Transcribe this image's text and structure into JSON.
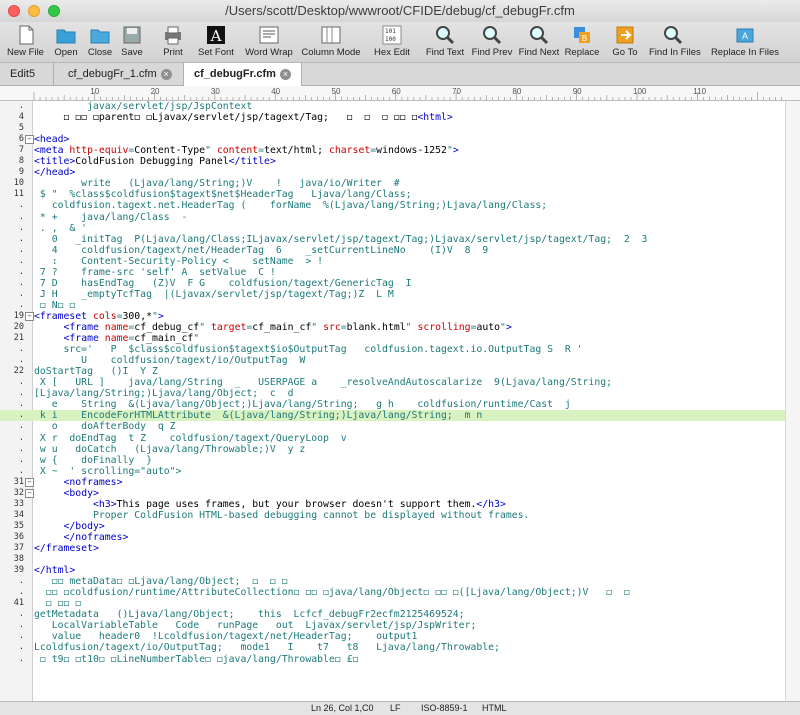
{
  "window": {
    "title": "/Users/scott/Desktop/wwwroot/CFIDE/debug/cf_debugFr.cfm"
  },
  "toolbar": [
    {
      "label": "New File",
      "icon": "new-file-icon"
    },
    {
      "label": "Open",
      "icon": "open-folder-icon"
    },
    {
      "label": "Close",
      "icon": "close-file-icon"
    },
    {
      "label": "Save",
      "icon": "save-icon"
    },
    {
      "label": "Print",
      "icon": "print-icon"
    },
    {
      "label": "Set Font",
      "icon": "font-icon"
    },
    {
      "label": "Word Wrap",
      "icon": "word-wrap-icon"
    },
    {
      "label": "Column Mode",
      "icon": "column-mode-icon"
    },
    {
      "label": "Hex Edit",
      "icon": "hex-edit-icon"
    },
    {
      "label": "Find Text",
      "icon": "find-text-icon"
    },
    {
      "label": "Find Prev",
      "icon": "find-prev-icon"
    },
    {
      "label": "Find Next",
      "icon": "find-next-icon"
    },
    {
      "label": "Replace",
      "icon": "replace-icon"
    },
    {
      "label": "Go To",
      "icon": "go-to-icon"
    },
    {
      "label": "Find In Files",
      "icon": "find-in-files-icon"
    },
    {
      "label": "Replace In Files",
      "icon": "replace-in-files-icon"
    }
  ],
  "tabs": [
    {
      "label": "Edit5",
      "active": false
    },
    {
      "label": "cf_debugFr_1.cfm",
      "active": false
    },
    {
      "label": "cf_debugFr.cfm",
      "active": true
    }
  ],
  "ruler": {
    "marks": [
      "10",
      "20",
      "30",
      "40",
      "50",
      "60",
      "70",
      "80",
      "90",
      "100",
      "110"
    ]
  },
  "lines": [
    {
      "n": ".",
      "fold": "",
      "text": "         javax/servlet/jsp/JspContext"
    },
    {
      "n": "4",
      "fold": "",
      "text": "     ◻ ◻◻ ◻parent◻ ◻Ljavax/servlet/jsp/tagext/Tag;   ◻  ◻  ◻ ◻◻ ◻<html>"
    },
    {
      "n": "5",
      "fold": "",
      "text": ""
    },
    {
      "n": "6",
      "fold": "−",
      "text": "<head>"
    },
    {
      "n": "7",
      "fold": "",
      "text": "<meta http-equiv=\"Content-Type\" content=\"text/html; charset=windows-1252\">"
    },
    {
      "n": "8",
      "fold": "",
      "text": "<title>ColdFusion Debugging Panel</title>"
    },
    {
      "n": "9",
      "fold": "",
      "text": "</head>"
    },
    {
      "n": "10",
      "fold": "",
      "text": "        write   (Ljava/lang/String;)V    !   java/io/Writer  #"
    },
    {
      "n": "11",
      "fold": "",
      "text": " $ \"  %class$coldfusion$tagext$net$HeaderTag   Ljava/lang/Class;"
    },
    {
      "n": ".",
      "fold": "",
      "text": "   coldfusion.tagext.net.HeaderTag (    forName  %(Ljava/lang/String;)Ljava/lang/Class;"
    },
    {
      "n": ".",
      "fold": "",
      "text": " * +    java/lang/Class  -"
    },
    {
      "n": ".",
      "fold": "",
      "text": " . ,  & '"
    },
    {
      "n": ".",
      "fold": "",
      "text": "   0   _initTag  P(Ljava/lang/Class;ILjavax/servlet/jsp/tagext/Tag;)Ljavax/servlet/jsp/tagext/Tag;  2  3"
    },
    {
      "n": ".",
      "fold": "",
      "text": "   4    coldfusion/tagext/net/HeaderTag  6    _setCurrentLineNo    (I)V  8  9"
    },
    {
      "n": ".",
      "fold": "",
      "text": "   :    Content-Security-Policy <    setName  > !"
    },
    {
      "n": ".",
      "fold": "",
      "text": " 7 ?    frame-src 'self' A  setValue  C !"
    },
    {
      "n": ".",
      "fold": "",
      "text": " 7 D    hasEndTag   (Z)V  F G    coldfusion/tagext/GenericTag  I"
    },
    {
      "n": ".",
      "fold": "",
      "text": " J H    _emptyTcfTag  |(Ljavax/servlet/jsp/tagext/Tag;)Z  L M"
    },
    {
      "n": ".",
      "fold": "",
      "text": " ◻ N◻ ◻"
    },
    {
      "n": "19",
      "fold": "−",
      "text": "<frameset cols=\"300,*\">"
    },
    {
      "n": "20",
      "fold": "",
      "text": "     <frame name=\"cf_debug_cf\" target=\"cf_main_cf\" src=\"blank.html\" scrolling=\"auto\">"
    },
    {
      "n": "21",
      "fold": "",
      "text": "     <frame name=\"cf_main_cf\""
    },
    {
      "n": ".",
      "fold": "",
      "text": "     src='   P  $class$coldfusion$tagext$io$OutputTag   coldfusion.tagext.io.OutputTag S  R '"
    },
    {
      "n": ".",
      "fold": "",
      "text": "        U    coldfusion/tagext/io/OutputTag  W"
    },
    {
      "n": "22",
      "fold": "",
      "text": "doStartTag   ()I  Y Z"
    },
    {
      "n": ".",
      "fold": "",
      "text": " X [   URL ]    java/lang/String  _   USERPAGE a    _resolveAndAutoscalarize  9(Ljava/lang/String;"
    },
    {
      "n": ".",
      "fold": "",
      "text": "[Ljava/lang/String;)Ljava/lang/Object;  c  d"
    },
    {
      "n": ".",
      "fold": "",
      "text": "   e    String  &(Ljava/lang/Object;)Ljava/lang/String;   g h    coldfusion/runtime/Cast  j"
    },
    {
      "n": ".",
      "fold": "",
      "text": " k i    EncodeForHTMLAttribute  &(Ljava/lang/String;)Ljava/lang/String;  m n",
      "hl": true
    },
    {
      "n": ".",
      "fold": "",
      "text": "   o    doAfterBody  q Z"
    },
    {
      "n": ".",
      "fold": "",
      "text": " X r  doEndTag  t Z    coldfusion/tagext/QueryLoop  v"
    },
    {
      "n": ".",
      "fold": "",
      "text": " w u   doCatch   (Ljava/lang/Throwable;)V  y z"
    },
    {
      "n": ".",
      "fold": "",
      "text": " w {    doFinally  }"
    },
    {
      "n": ".",
      "fold": "",
      "text": " X ~  ' scrolling=\"auto\">"
    },
    {
      "n": "31",
      "fold": "−",
      "text": "     <noframes>"
    },
    {
      "n": "32",
      "fold": "−",
      "text": "     <body>"
    },
    {
      "n": "33",
      "fold": "",
      "text": "          <h3>This page uses frames, but your browser doesn't support them.</h3>"
    },
    {
      "n": "34",
      "fold": "",
      "text": "          Proper ColdFusion HTML-based debugging cannot be displayed without frames."
    },
    {
      "n": "35",
      "fold": "",
      "text": "     </body>"
    },
    {
      "n": "36",
      "fold": "",
      "text": "     </noframes>"
    },
    {
      "n": "37",
      "fold": "",
      "text": "</frameset>"
    },
    {
      "n": "38",
      "fold": "",
      "text": ""
    },
    {
      "n": "39",
      "fold": "",
      "text": "</html>"
    },
    {
      "n": ".",
      "fold": "",
      "text": "   ◻◻ metaData◻ ◻Ljava/lang/Object;  ◻  ◻ ◻"
    },
    {
      "n": ".",
      "fold": "",
      "text": "  ◻◻ ◻coldfusion/runtime/AttributeCollection◻ ◻◻ ◻java/lang/Object◻ ◻◻ ◻([Ljava/lang/Object;)V   ◻  ◻"
    },
    {
      "n": "41",
      "fold": "",
      "text": "  ◻ ◻◻ ◻"
    },
    {
      "n": ".",
      "fold": "",
      "text": "getMetadata   ()Ljava/lang/Object;    this  Lcfcf_debugFr2ecfm2125469524;"
    },
    {
      "n": ".",
      "fold": "",
      "text": "   LocalVariableTable   Code   runPage   out  Ljavax/servlet/jsp/JspWriter;"
    },
    {
      "n": ".",
      "fold": "",
      "text": "   value   header0  !Lcoldfusion/tagext/net/HeaderTag;    output1"
    },
    {
      "n": ".",
      "fold": "",
      "text": "Lcoldfusion/tagext/io/OutputTag;   mode1   I    t7   t8   Ljava/lang/Throwable;"
    },
    {
      "n": ".",
      "fold": "",
      "text": " ◻ t9◻ ◻t10◻ ◻LineNumberTable◻ ◻java/lang/Throwable◻ £◻"
    },
    {
      "n": "",
      "fold": "",
      "text": ""
    },
    {
      "n": "",
      "fold": "",
      "text": ""
    }
  ],
  "status": {
    "position": "Ln 26, Col 1,C0",
    "line_ending": "LF",
    "encoding": "ISO-8859-1",
    "mode": "HTML"
  },
  "colors": {
    "code_teal": "#1f7a7a",
    "tag_blue": "#0000cc",
    "attr_red": "#cc0000",
    "highlight": "#d9f2c2"
  }
}
